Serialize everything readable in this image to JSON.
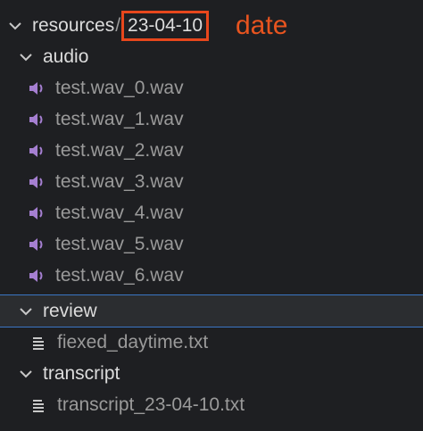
{
  "explorer": {
    "root": {
      "name": "resources",
      "separator": "/",
      "subfolder": "23-04-10",
      "expanded": true
    },
    "annotation": {
      "text": "date",
      "color": "#e8541f"
    },
    "folders": {
      "audio": {
        "label": "audio",
        "expanded": true,
        "files": [
          "test.wav_0.wav",
          "test.wav_1.wav",
          "test.wav_2.wav",
          "test.wav_3.wav",
          "test.wav_4.wav",
          "test.wav_5.wav",
          "test.wav_6.wav"
        ]
      },
      "review": {
        "label": "review",
        "expanded": true,
        "selected": true,
        "files": [
          "fiexed_daytime.txt"
        ]
      },
      "transcript": {
        "label": "transcript",
        "expanded": true,
        "files": [
          "transcript_23-04-10.txt"
        ]
      }
    },
    "colors": {
      "background": "#1e1f22",
      "audio_icon": "#a57fd1",
      "text_icon": "#c8c8c8",
      "selection_border": "#3a75c4",
      "highlight_box": "#e8471c"
    }
  }
}
